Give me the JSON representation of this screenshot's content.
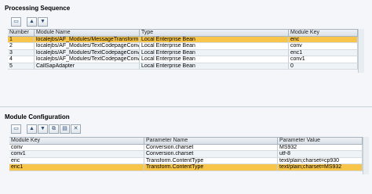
{
  "processing_sequence": {
    "title": "Processing Sequence",
    "toolbar": {
      "insert_icon": "insert-row-icon",
      "up_icon": "arrow-up-icon",
      "down_icon": "arrow-down-icon"
    },
    "columns": [
      "Number",
      "Module Name",
      "Type",
      "Module Key"
    ],
    "rows": [
      [
        "1",
        "localejbs/AF_Modules/MessageTransformBean",
        "Local Enterprise Bean",
        "enc"
      ],
      [
        "2",
        "localejbs/AF_Modules/TextCodepageConversio...",
        "Local Enterprise Bean",
        "conv"
      ],
      [
        "3",
        "localejbs/AF_Modules/TextCodepageConversio...",
        "Local Enterprise Bean",
        "enc1"
      ],
      [
        "4",
        "localejbs/AF_Modules/TextCodepageConversio...",
        "Local Enterprise Bean",
        "conv1"
      ],
      [
        "5",
        "CallSapAdapter",
        "Local Enterprise Bean",
        "0"
      ]
    ],
    "selected_row": 0,
    "selected_color": "#f7c54a"
  },
  "module_configuration": {
    "title": "Module Configuration",
    "toolbar": {
      "insert_icon": "insert-row-icon",
      "up_icon": "arrow-up-icon",
      "down_icon": "arrow-down-icon",
      "copy_icon": "copy-icon",
      "paste_icon": "paste-icon",
      "delete_icon": "delete-icon"
    },
    "columns": [
      "Module Key",
      "Parameter Name",
      "Parameter Value"
    ],
    "rows": [
      [
        "conv",
        "Conversion.charset",
        "MS932"
      ],
      [
        "conv1",
        "Conversion.charset",
        "utf-8"
      ],
      [
        "enc",
        "Transform.ContentType",
        "text/plain;charset=cp930"
      ],
      [
        "enc1",
        "Transform.ContentType",
        "text/plain;charset=MS932"
      ]
    ],
    "selected_row": 3
  }
}
